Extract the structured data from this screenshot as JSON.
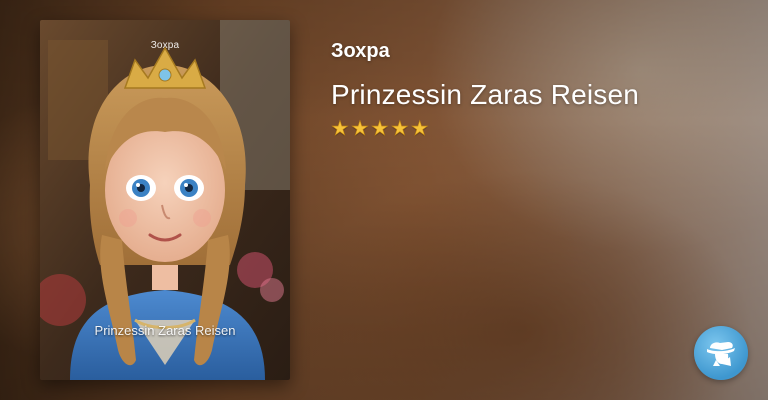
{
  "book": {
    "author": "Зохра",
    "title": "Prinzessin Zaras Reisen",
    "rating_stars": 5,
    "rating_max": 5,
    "cover": {
      "watermark": "Зохра",
      "caption": "Prinzessin Zaras Reisen"
    }
  },
  "icons": {
    "star": "star-icon",
    "app_badge": "storyteller-hat-icon"
  },
  "colors": {
    "star": "#f6c23a",
    "badge": "#4aa3d8",
    "text": "#ffffff"
  }
}
